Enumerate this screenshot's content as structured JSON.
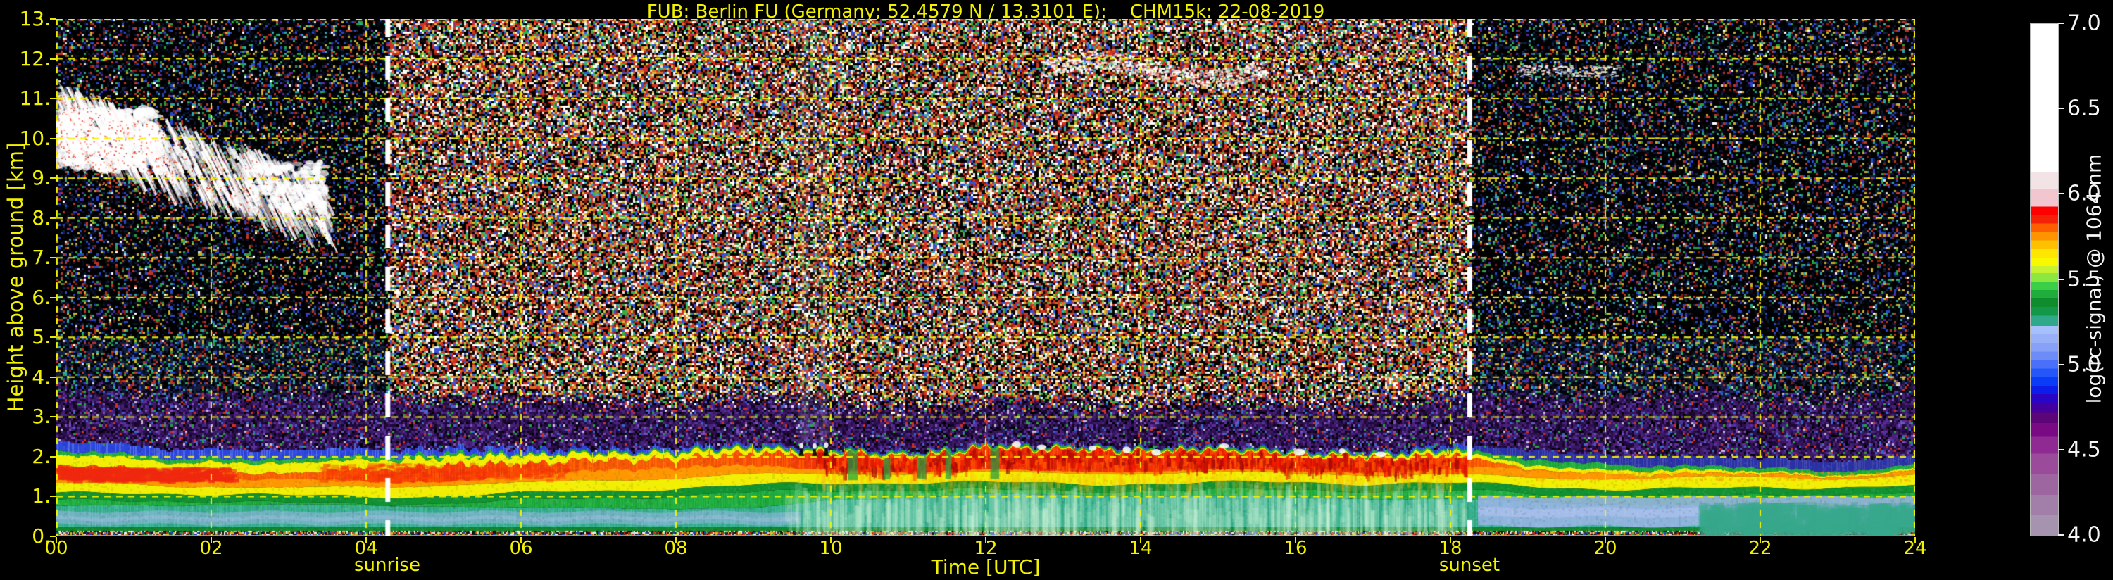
{
  "title": "FUB: Berlin FU (Germany; 52.4579 N / 13.3101 E):    CHM15k: 22-08-2019",
  "axes": {
    "x_label": "Time [UTC]",
    "y_label": "Height above ground [km]",
    "x_ticks": [
      "00",
      "02",
      "04",
      "06",
      "08",
      "10",
      "12",
      "14",
      "16",
      "18",
      "20",
      "22",
      "24"
    ],
    "y_ticks": [
      "0.",
      "1.",
      "2.",
      "3.",
      "4.",
      "5.",
      "6.",
      "7.",
      "8.",
      "9.",
      "10.",
      "11.",
      "12.",
      "13."
    ],
    "annotations": {
      "sunrise_label": "sunrise",
      "sunset_label": "sunset"
    }
  },
  "colorbar": {
    "title": "log(rc-signal) @ 1064 nm",
    "tick_labels": [
      "7.0",
      "6.5",
      "6.0",
      "5.5",
      "5.0",
      "4.5",
      "4.0"
    ],
    "tick_values": [
      7.0,
      6.5,
      6.0,
      5.5,
      5.0,
      4.5,
      4.0
    ],
    "stops": [
      [
        4.0,
        "#a593b0"
      ],
      [
        4.12,
        "#a27fa8"
      ],
      [
        4.24,
        "#9d66a0"
      ],
      [
        4.36,
        "#9a4c9a"
      ],
      [
        4.48,
        "#8f2a92"
      ],
      [
        4.58,
        "#7a0a84"
      ],
      [
        4.66,
        "#5c0578"
      ],
      [
        4.72,
        "#43009e"
      ],
      [
        4.78,
        "#2a06c4"
      ],
      [
        4.83,
        "#0d1ce8"
      ],
      [
        4.88,
        "#0a3cf8"
      ],
      [
        4.93,
        "#2456fa"
      ],
      [
        4.98,
        "#4a70fa"
      ],
      [
        5.03,
        "#6e8cf8"
      ],
      [
        5.08,
        "#87a0f8"
      ],
      [
        5.13,
        "#97b0f8"
      ],
      [
        5.18,
        "#a5c0fa"
      ],
      [
        5.23,
        "#2fa989"
      ],
      [
        5.29,
        "#13984a"
      ],
      [
        5.34,
        "#0f8c2c"
      ],
      [
        5.39,
        "#1fae3c"
      ],
      [
        5.44,
        "#3bcf48"
      ],
      [
        5.49,
        "#8ce83e"
      ],
      [
        5.54,
        "#c6f232"
      ],
      [
        5.58,
        "#f8f800"
      ],
      [
        5.63,
        "#ffe600"
      ],
      [
        5.68,
        "#ffc000"
      ],
      [
        5.73,
        "#ff9400"
      ],
      [
        5.78,
        "#ff5e00"
      ],
      [
        5.83,
        "#f52008"
      ],
      [
        5.88,
        "#fe0000"
      ],
      [
        5.93,
        "#f2c6ce"
      ],
      [
        6.03,
        "#f3e2e6"
      ],
      [
        6.13,
        "#ffffff"
      ]
    ]
  },
  "colors": {
    "background": "#000000",
    "axis_text": "#f2f200",
    "grid": "rgba(244,244,0,0.95)",
    "sun_line": "#ffffff",
    "colorbar_text": "#f5f5f5"
  },
  "chart_data": {
    "type": "heatmap",
    "title": "FUB: Berlin FU (Germany; 52.4579 N / 13.3101 E):    CHM15k: 22-08-2019",
    "xlabel": "Time [UTC]",
    "ylabel": "Height above ground [km]",
    "value_label": "log(rc-signal) @ 1064 nm",
    "x_range_utc_h": [
      0,
      24
    ],
    "y_range_km": [
      0,
      13
    ],
    "value_range": [
      4.0,
      7.0
    ],
    "sunrise_utc_h": 4.28,
    "sunset_utc_h": 18.25,
    "hours": [
      0,
      1,
      2,
      3,
      4,
      5,
      6,
      7,
      8,
      9,
      10,
      11,
      12,
      13,
      14,
      15,
      16,
      17,
      18,
      19,
      20,
      21,
      22,
      23,
      24
    ],
    "layers": {
      "teal_top_km": [
        0.75,
        0.78,
        0.8,
        0.8,
        0.78,
        0.75,
        0.72,
        0.7,
        0.68,
        0.66,
        0.9,
        1.0,
        1.05,
        1.05,
        1.0,
        1.0,
        1.0,
        0.95,
        0.9,
        0.85,
        0.8,
        0.8,
        0.8,
        0.8,
        0.8
      ],
      "yellow_bottom_km": [
        1.05,
        1.05,
        1.05,
        1.0,
        1.0,
        1.05,
        1.1,
        1.15,
        1.2,
        1.25,
        1.3,
        1.35,
        1.35,
        1.35,
        1.35,
        1.35,
        1.35,
        1.3,
        1.3,
        1.25,
        1.2,
        1.2,
        1.25,
        1.25,
        1.25
      ],
      "orange_bottom_km": [
        1.3,
        1.3,
        1.25,
        1.2,
        1.25,
        1.3,
        1.35,
        1.4,
        1.45,
        1.5,
        1.55,
        1.6,
        1.6,
        1.6,
        1.6,
        1.6,
        1.6,
        1.55,
        1.5,
        1.45,
        1.45,
        1.5,
        1.55,
        1.5,
        1.5
      ],
      "red_top_km": [
        1.75,
        1.7,
        1.65,
        1.6,
        1.65,
        1.75,
        1.8,
        1.85,
        1.9,
        1.95,
        2.05,
        2.1,
        2.15,
        2.15,
        2.1,
        2.1,
        2.1,
        2.05,
        1.95,
        1.6,
        1.55,
        1.6,
        1.65,
        1.6,
        1.6
      ],
      "upper_yellow_km": [
        0.25,
        0.25,
        0.25,
        0.25,
        0.25,
        0.2,
        0.2,
        0.15,
        0.15,
        0.12,
        0.05,
        0.04,
        0.04,
        0.04,
        0.04,
        0.04,
        0.04,
        0.05,
        0.1,
        0.1,
        0.1,
        0.1,
        0.05,
        0.05,
        0.05
      ],
      "upper_green_km": [
        0.1,
        0.1,
        0.1,
        0.1,
        0.1,
        0.1,
        0.05,
        0.05,
        0.05,
        0.05,
        0.05,
        0.05,
        0.05,
        0.05,
        0.05,
        0.05,
        0.05,
        0.05,
        0.05,
        0.15,
        0.15,
        0.1,
        0.1,
        0.1,
        0.1
      ],
      "upper_blue_km": [
        0.25,
        0.25,
        0.25,
        0.25,
        0.2,
        0.15,
        0.15,
        0.1,
        0.1,
        0.08,
        0.05,
        0.05,
        0.05,
        0.05,
        0.05,
        0.05,
        0.05,
        0.05,
        0.1,
        0.25,
        0.25,
        0.25,
        0.25,
        0.25,
        0.25
      ],
      "purple_top_km": [
        3.35,
        3.35,
        3.3,
        3.3,
        3.3,
        3.25,
        3.2,
        3.15,
        3.1,
        3.1,
        3.1,
        3.1,
        3.1,
        3.1,
        3.1,
        3.1,
        3.1,
        3.1,
        3.15,
        3.25,
        3.3,
        3.35,
        3.35,
        3.35,
        3.35
      ],
      "red_strength": [
        0.85,
        0.8,
        0.5,
        0.4,
        0.7,
        0.8,
        0.7,
        0.5,
        0.45,
        0.6,
        0.85,
        0.9,
        0.92,
        0.92,
        0.9,
        0.9,
        0.9,
        0.85,
        0.75,
        0.15,
        0.05,
        0.1,
        0.15,
        0.1,
        0.05
      ]
    },
    "lavender_bands": [
      {
        "t0": 0.0,
        "t1": 9.6,
        "lo_km": 0.3,
        "hi_km": 0.62
      },
      {
        "t0": 18.35,
        "t1": 24.0,
        "lo_km": 0.25,
        "hi_km": 1.0
      }
    ],
    "clouds": [
      {
        "name": "cirrus-fallstreaks",
        "t0": 0.0,
        "t1": 3.5,
        "base_km": 8.1,
        "top_km": 11.6
      },
      {
        "name": "thin-cirrus",
        "t0": 12.7,
        "t1": 15.6,
        "base_km": 11.5,
        "top_km": 12.2
      },
      {
        "name": "thin-cirrus",
        "t0": 18.85,
        "t1": 20.2,
        "base_km": 11.55,
        "top_km": 11.95
      },
      {
        "name": "bl-top-cumulus",
        "t0": 9.55,
        "t1": 10.0,
        "base_km": 2.05,
        "top_km": 2.45
      }
    ]
  }
}
